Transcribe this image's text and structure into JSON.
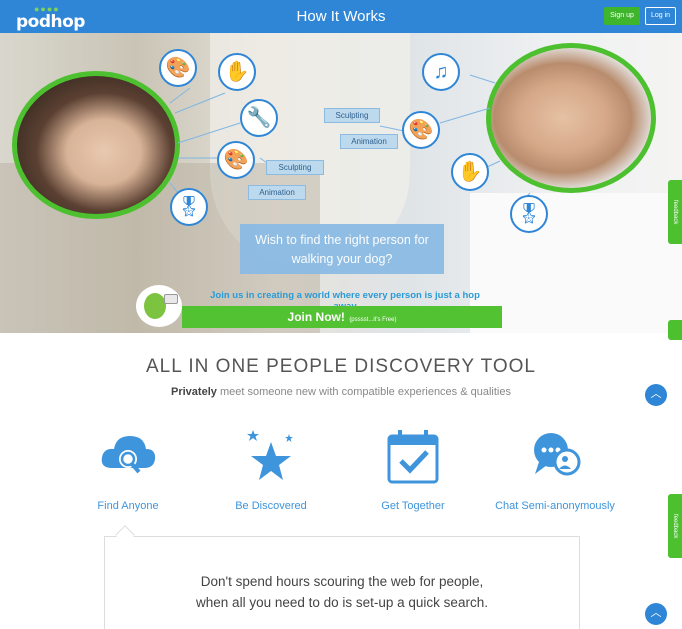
{
  "header": {
    "logo_text": "podhop",
    "title": "How It Works",
    "signup_label": "Sign up",
    "login_label": "Log in"
  },
  "hero": {
    "tags": [
      "Sculpting",
      "Animation",
      "Sculpting",
      "Animation"
    ],
    "question": "Wish to find the right person for walking your dog?",
    "join_text": "Join us in creating a world where every person is just a hop away",
    "join_button": "Join Now!",
    "join_button_sub": "(psssst...it's Free)",
    "icons": [
      "palette-icon",
      "hand-icon",
      "tools-icon",
      "palette-icon",
      "ribbon-icon",
      "music-icon",
      "palette-icon",
      "hand-icon",
      "ribbon-icon"
    ]
  },
  "feedback_label": "feedback",
  "discovery": {
    "title": "ALL IN ONE PEOPLE DISCOVERY TOOL",
    "subtitle_bold": "Privately",
    "subtitle_rest": "meet someone new with compatible experiences & qualities",
    "features": [
      {
        "label": "Find Anyone",
        "icon": "cloud-search-icon"
      },
      {
        "label": "Be Discovered",
        "icon": "star-icon"
      },
      {
        "label": "Get Together",
        "icon": "calendar-check-icon"
      },
      {
        "label": "Chat Semi-anonymously",
        "icon": "chat-bubbles-icon"
      }
    ],
    "card_text_line1": "Don't spend hours scouring the web for people,",
    "card_text_line2": "when all you need to do is set-up a quick search."
  },
  "colors": {
    "brand_blue": "#2f86d6",
    "brand_green": "#4cc02e",
    "feature_blue": "#3f95dc"
  }
}
